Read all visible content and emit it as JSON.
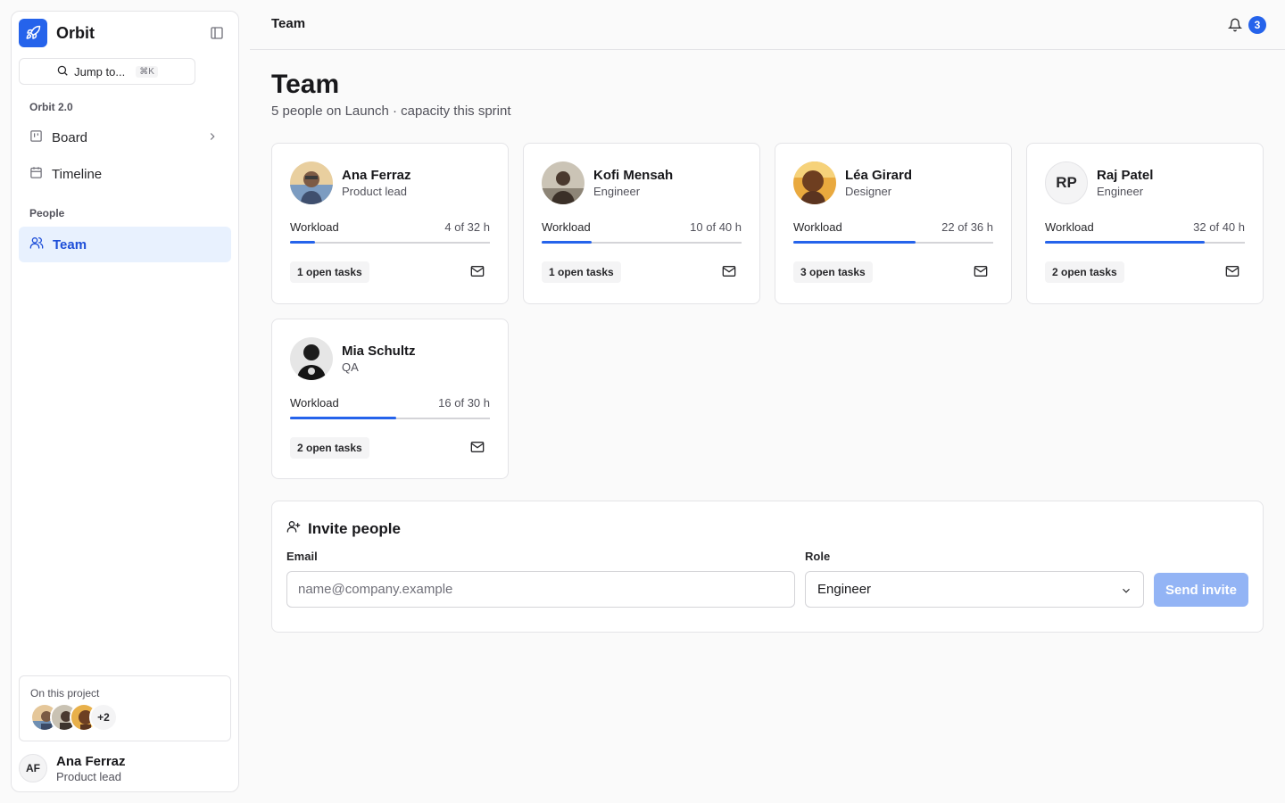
{
  "app": {
    "name": "Orbit"
  },
  "colors": {
    "accent": "#2563eb",
    "accent_soft": "#e8f1fe",
    "border": "#e4e4e7",
    "disabled_button": "#93b4f5"
  },
  "sidebar": {
    "search": {
      "label": "Jump to...",
      "shortcut": "⌘K"
    },
    "groups": [
      {
        "label": "Orbit 2.0"
      },
      {
        "label": "People"
      }
    ],
    "items": [
      {
        "label": "Board",
        "icon": "board-icon",
        "has_chevron": true
      },
      {
        "label": "Timeline",
        "icon": "calendar-icon"
      },
      {
        "label": "Team",
        "icon": "users-icon",
        "active": true
      }
    ],
    "project": {
      "label": "On this project",
      "more_count": "+2"
    },
    "user": {
      "initials": "AF",
      "name": "Ana Ferraz",
      "role": "Product lead"
    }
  },
  "header": {
    "breadcrumb": "Team",
    "notification_count": "3"
  },
  "page": {
    "title": "Team",
    "subtitle": "5 people on Launch · capacity this sprint"
  },
  "members": [
    {
      "name": "Ana Ferraz",
      "role": "Product lead",
      "workload_label": "Workload",
      "hours": "4 of 32 h",
      "load": 0.125,
      "tasks": "1 open tasks",
      "avatar": "photo"
    },
    {
      "name": "Kofi Mensah",
      "role": "Engineer",
      "workload_label": "Workload",
      "hours": "10 of 40 h",
      "load": 0.25,
      "tasks": "1 open tasks",
      "avatar": "photo"
    },
    {
      "name": "Léa Girard",
      "role": "Designer",
      "workload_label": "Workload",
      "hours": "22 of 36 h",
      "load": 0.611,
      "tasks": "3 open tasks",
      "avatar": "photo"
    },
    {
      "name": "Raj Patel",
      "role": "Engineer",
      "workload_label": "Workload",
      "hours": "32 of 40 h",
      "load": 0.8,
      "tasks": "2 open tasks",
      "avatar": "initials",
      "initials": "RP"
    },
    {
      "name": "Mia Schultz",
      "role": "QA",
      "workload_label": "Workload",
      "hours": "16 of 30 h",
      "load": 0.533,
      "tasks": "2 open tasks",
      "avatar": "photo"
    }
  ],
  "invite": {
    "title": "Invite people",
    "email_label": "Email",
    "email_placeholder": "name@company.example",
    "email_value": "",
    "role_label": "Role",
    "role_value": "Engineer",
    "send_label": "Send invite"
  }
}
